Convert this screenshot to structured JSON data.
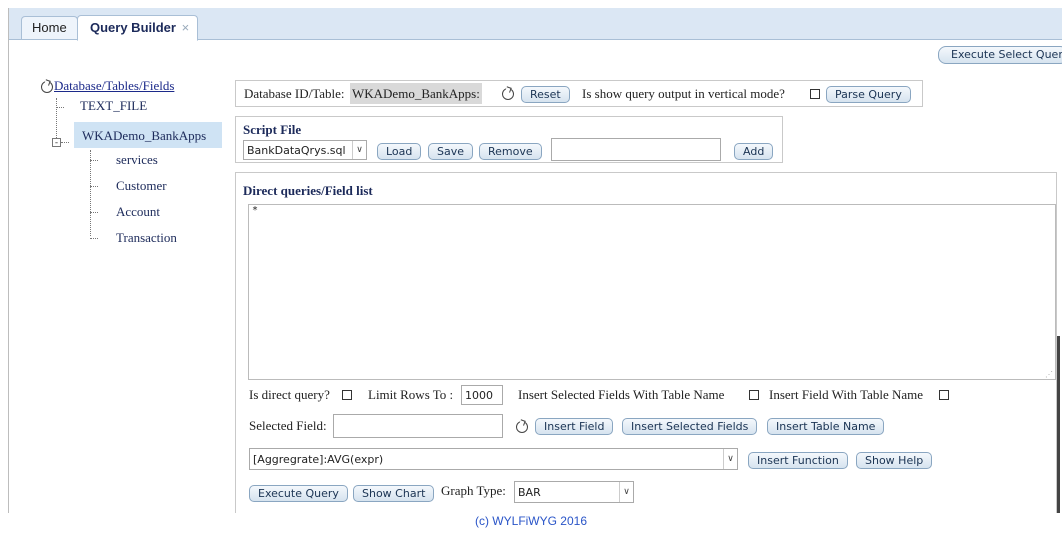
{
  "tabs": [
    {
      "label": "Home"
    },
    {
      "label": "Query Builder",
      "close": "×"
    }
  ],
  "toolbar": {
    "execute_select_label": "Execute Select Quer"
  },
  "tree": {
    "root": "Database/Tables/Fields",
    "items": [
      {
        "label": "TEXT_FILE"
      },
      {
        "label": "WKADemo_BankApps",
        "selected": true,
        "children": [
          "services",
          "Customer",
          "Account",
          "Transaction"
        ]
      }
    ]
  },
  "db_bar": {
    "label": "Database ID/Table:",
    "value": "WKADemo_BankApps:",
    "reset": "Reset",
    "vertical_label": "Is show query output in vertical mode?",
    "parse": "Parse Query"
  },
  "script_file": {
    "title": "Script File",
    "selected": "BankDataQrys.sql",
    "load": "Load",
    "save": "Save",
    "remove": "Remove",
    "new_name": "",
    "add": "Add"
  },
  "direct": {
    "title": "Direct queries/Field list",
    "query_text": "*",
    "is_direct_label": "Is direct query?",
    "limit_label": "Limit Rows To :",
    "limit_value": "1000",
    "insert_sel_with_table_label": "Insert Selected Fields With Table Name",
    "insert_field_with_table_label": "Insert Field With Table Name",
    "selected_field_label": "Selected Field:",
    "selected_field_value": "",
    "insert_field": "Insert Field",
    "insert_selected_fields": "Insert Selected Fields",
    "insert_table_name": "Insert Table Name",
    "function_selected": "[Aggregrate]:AVG(expr)",
    "insert_function": "Insert Function",
    "show_help": "Show Help",
    "execute_query": "Execute Query",
    "show_chart": "Show Chart",
    "graph_type_label": "Graph Type:",
    "graph_type_value": "BAR"
  },
  "footer": {
    "text": "(c) WYLFiWYG 2016"
  },
  "colors": {
    "tab_bar": "#dbe7f4",
    "link_blue": "#1c2a8a",
    "footer_blue": "#2a55c8",
    "selected_bg": "#cfe3f4"
  }
}
